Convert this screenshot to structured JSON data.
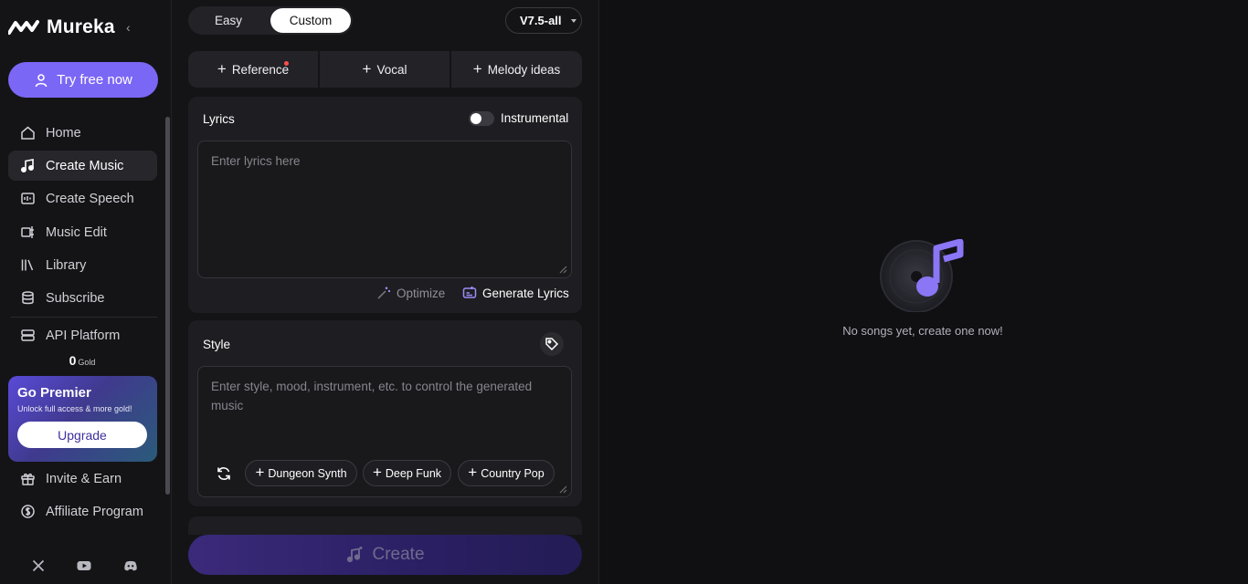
{
  "sidebar": {
    "brand": "Mureka",
    "try_button": "Try free now",
    "nav": [
      {
        "label": "Home",
        "icon": "home-icon"
      },
      {
        "label": "Create Music",
        "icon": "music-note-icon",
        "active": true
      },
      {
        "label": "Create Speech",
        "icon": "speech-icon"
      },
      {
        "label": "Music Edit",
        "icon": "music-edit-icon"
      },
      {
        "label": "Library",
        "icon": "library-icon"
      },
      {
        "label": "Subscribe",
        "icon": "subscribe-icon"
      },
      {
        "label": "API Platform",
        "icon": "api-icon"
      },
      {
        "label": "Invite & Earn",
        "icon": "gift-icon"
      },
      {
        "label": "Affiliate Program",
        "icon": "dollar-icon"
      }
    ],
    "gold_value": "0",
    "gold_unit": "Gold",
    "premier": {
      "title": "Go Premier",
      "subtitle": "Unlock full access & more gold!",
      "button": "Upgrade"
    },
    "social": [
      "x-icon",
      "youtube-icon",
      "discord-icon"
    ]
  },
  "form": {
    "modes": [
      "Easy",
      "Custom"
    ],
    "selected_mode": "Custom",
    "version": "V7.5-all",
    "add_buttons": [
      "Reference",
      "Vocal",
      "Melody ideas"
    ],
    "lyrics": {
      "label": "Lyrics",
      "instrumental_label": "Instrumental",
      "instrumental_on": false,
      "placeholder": "Enter lyrics here",
      "value": "",
      "optimize": "Optimize",
      "generate": "Generate Lyrics"
    },
    "style": {
      "label": "Style",
      "placeholder": "Enter style, mood, instrument, etc. to control the generated music",
      "value": "",
      "chips": [
        "Dungeon Synth",
        "Deep Funk",
        "Country Pop"
      ]
    },
    "create_button": "Create"
  },
  "empty_state": {
    "text": "No songs yet, create one now!"
  },
  "colors": {
    "accent": "#7b67f5",
    "background": "#101013",
    "panel": "#1e1e22"
  }
}
